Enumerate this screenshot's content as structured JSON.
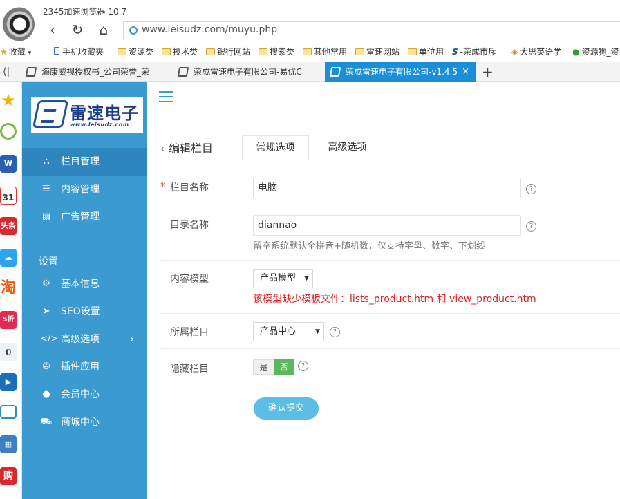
{
  "browser": {
    "title": "2345加速浏览器 10.7",
    "url": "www.leisudz.com/muyu.php",
    "bookmarks": [
      "收藏",
      "手机收藏夹",
      "资源类",
      "技术类",
      "银行网站",
      "搜索类",
      "其他常用",
      "雷速网站",
      "单位用",
      "-荣成市斥",
      "大思英语学",
      "资源狗_资"
    ],
    "tabs": [
      {
        "label": "海康威视授权书_公司荣誉_荣",
        "active": false
      },
      {
        "label": "荣成雷速电子有限公司-易优C",
        "active": false
      },
      {
        "label": "荣成雷速电子有限公司-v1.4.5",
        "active": true
      }
    ],
    "close_glyph": "×",
    "new_tab_glyph": "+",
    "tab_scroll_glyph": "⟨|"
  },
  "appbar": {
    "icons": [
      "favorite-star-icon",
      "history-clock-icon",
      "word-doc-icon",
      "calendar-icon",
      "toutiao-news-icon",
      "weather-icon",
      "taobao-icon",
      "discount-icon",
      "game-controller-icon",
      "video-player-icon",
      "monitor-icon",
      "calculator-icon",
      "shopping-icon"
    ],
    "calendar_day": "31",
    "toutiao_text": "头条",
    "taobao_text": "淘",
    "discount_text": "5折",
    "shop_text": "购"
  },
  "logo": {
    "name": "雷速电子",
    "url": "www.leisudz.com"
  },
  "sidebar": {
    "items": [
      {
        "label": "栏目管理",
        "icon": "sitemap-icon",
        "active": true
      },
      {
        "label": "内容管理",
        "icon": "list-icon",
        "active": false
      },
      {
        "label": "广告管理",
        "icon": "image-icon",
        "active": false
      }
    ],
    "section_settings": "设置",
    "settings_items": [
      {
        "label": "基本信息",
        "icon": "gear-icon"
      },
      {
        "label": "SEO设置",
        "icon": "paper-plane-icon"
      },
      {
        "label": "高级选项",
        "icon": "code-icon",
        "arrow": "›"
      },
      {
        "label": "插件应用",
        "icon": "puzzle-icon"
      },
      {
        "label": "会员中心",
        "icon": "user-icon"
      },
      {
        "label": "商城中心",
        "icon": "cart-icon"
      }
    ]
  },
  "page": {
    "back_title": "编辑栏目",
    "tabs": [
      "常规选项",
      "高级选项"
    ],
    "fields": {
      "column_name": {
        "label": "栏目名称",
        "value": "电脑",
        "required_mark": "*"
      },
      "dir_name": {
        "label": "目录名称",
        "value": "diannao",
        "hint": "留空系统默认全拼音+随机数，仅支持字母、数字、下划线"
      },
      "content_model": {
        "label": "内容模型",
        "value": "产品模型",
        "warning": "该模型缺少模板文件：lists_product.htm 和 view_product.htm"
      },
      "parent_column": {
        "label": "所属栏目",
        "value": "产品中心"
      },
      "hidden_column": {
        "label": "隐藏栏目",
        "yes": "是",
        "no": "否",
        "selected": "否"
      }
    },
    "help_glyph": "?",
    "submit_label": "确认提交"
  },
  "colors": {
    "sidebar_bg": "#3b9ad0",
    "sidebar_active": "#2e86bf",
    "tab_active": "#1b8fd6",
    "warning": "#e02020",
    "toggle_on": "#5cb85c",
    "submit_bg": "#5cbde6"
  }
}
